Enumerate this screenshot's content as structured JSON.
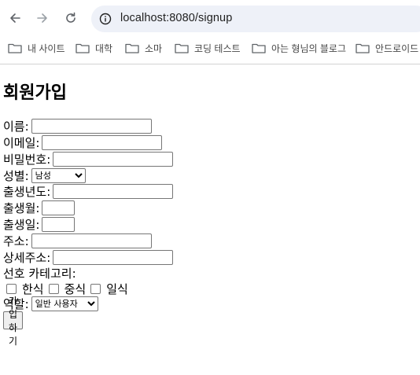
{
  "browser": {
    "url": "localhost:8080/signup",
    "bookmarks": [
      {
        "label": "내 사이트"
      },
      {
        "label": "대학"
      },
      {
        "label": "소마"
      },
      {
        "label": "코딩 테스트"
      },
      {
        "label": "아는 형님의 블로그"
      },
      {
        "label": "안드로이드"
      }
    ]
  },
  "form": {
    "title": "회원가입",
    "fields": {
      "name": {
        "label": "이름:",
        "value": ""
      },
      "email": {
        "label": "이메일:",
        "value": ""
      },
      "password": {
        "label": "비밀번호:",
        "value": ""
      },
      "gender": {
        "label": "성별:",
        "selected": "남성"
      },
      "birth_year": {
        "label": "출생년도:",
        "value": ""
      },
      "birth_month": {
        "label": "출생월:",
        "value": ""
      },
      "birth_day": {
        "label": "출생일:",
        "value": ""
      },
      "address": {
        "label": "주소:",
        "value": ""
      },
      "address_detail": {
        "label": "상세주소:",
        "value": ""
      },
      "role": {
        "label": "역할:",
        "selected": "일반 사용자"
      }
    },
    "category": {
      "label": "선호 카테고리:",
      "options": [
        {
          "label": "한식",
          "checked": false
        },
        {
          "label": "중식",
          "checked": false
        },
        {
          "label": "일식",
          "checked": false
        }
      ]
    },
    "submit_label": "가입하기"
  }
}
